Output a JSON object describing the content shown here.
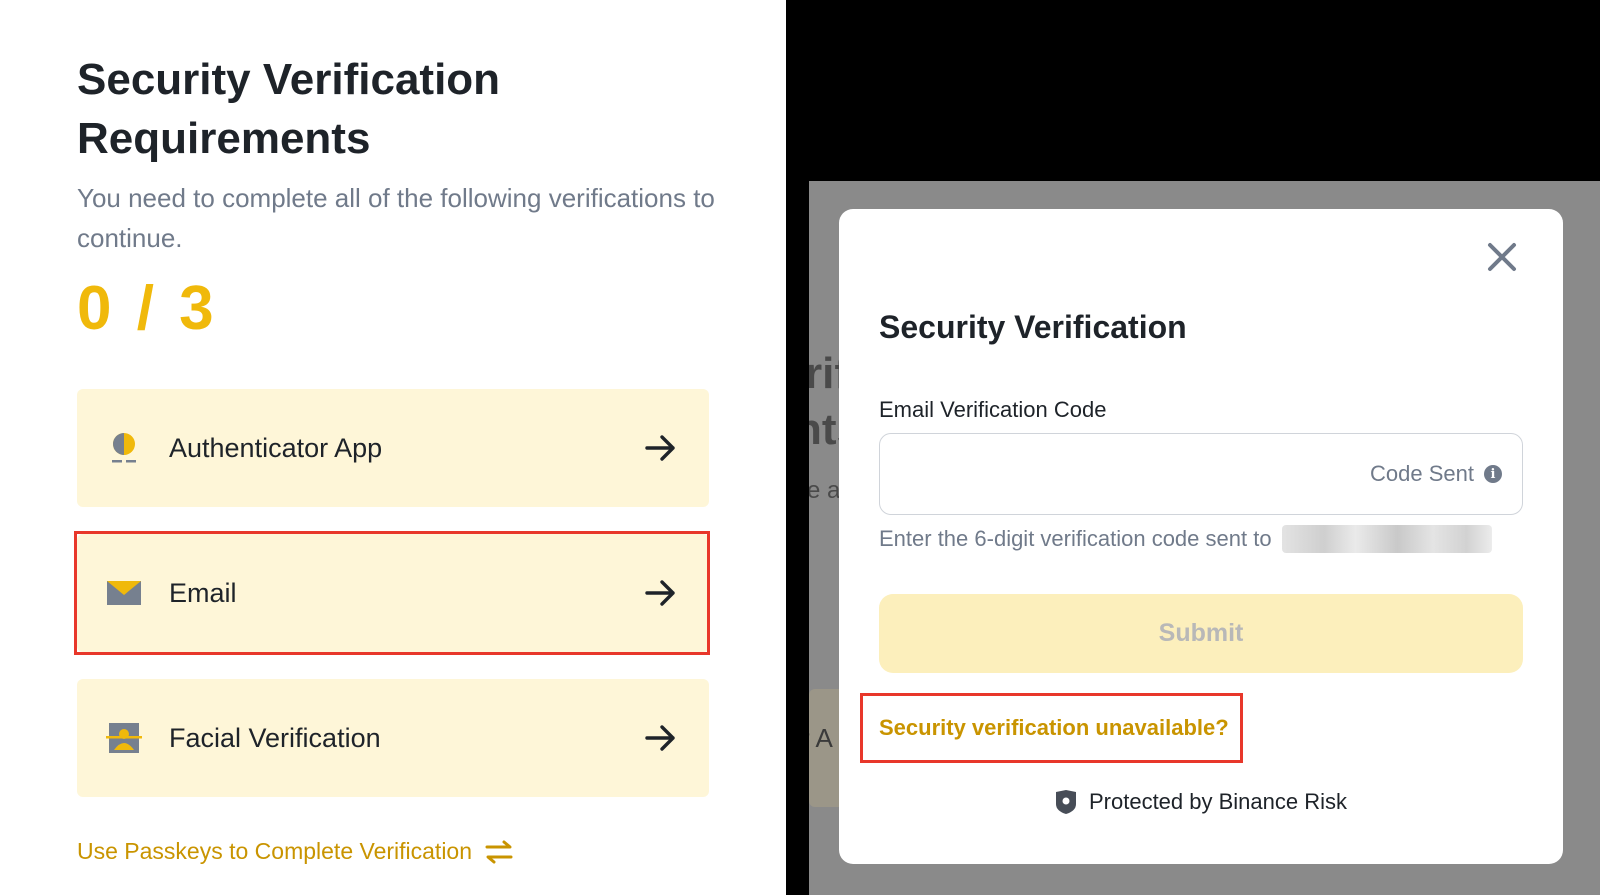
{
  "left": {
    "title": "Security Verification Requirements",
    "subtitle": "You need to complete all of the following verifications to continue.",
    "progress": "0 / 3",
    "items": [
      {
        "label": "Authenticator App",
        "icon": "authenticator-icon"
      },
      {
        "label": "Email",
        "icon": "email-icon"
      },
      {
        "label": "Facial Verification",
        "icon": "face-icon"
      }
    ],
    "passkeys_link": "Use Passkeys to Complete Verification"
  },
  "background_ghost": {
    "title_fragment_1": "rif",
    "title_fragment_2": "nts",
    "subtitle_fragment": "e al",
    "item_fragment": "r A"
  },
  "modal": {
    "title": "Security Verification",
    "field_label": "Email Verification Code",
    "field_value": "",
    "code_sent": "Code Sent",
    "hint": "Enter the 6-digit verification code sent to",
    "submit_label": "Submit",
    "unavailable_link": "Security verification unavailable?",
    "protected_text": "Protected by Binance Risk"
  },
  "colors": {
    "accent": "#f0b90b",
    "link": "#c99400",
    "item_bg": "#fef6d8",
    "highlight": "#e8372a",
    "submit_bg": "#fcefbc"
  }
}
